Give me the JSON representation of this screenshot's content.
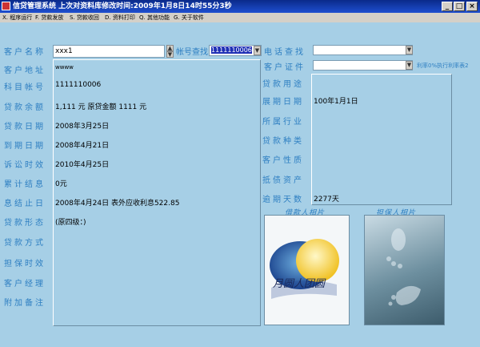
{
  "window": {
    "title": "信贷管理系统   上次对资料库修改时间:2009年1月8日14时55分3秒"
  },
  "menu": [
    "X. 程序运行",
    "F. 贷款发放",
    "S. 贷款收回",
    "D. 资料打印",
    "Q. 其他功能",
    "G. 关于软件"
  ],
  "search": {
    "name_label": "客户名称",
    "name_value": "xxx1",
    "account_label": "帐号查找",
    "account_value": "1111110006",
    "phone_label": "电话查找",
    "cert_label": "客户证件",
    "rate_note": "利率0%执行利率表2"
  },
  "left_fields": [
    {
      "label": "客户地址",
      "value": "wwww"
    },
    {
      "label": "科目帐号",
      "value": "1111110006"
    },
    {
      "label": "贷款余额",
      "value": "1,111 元 原贷金额 1111 元"
    },
    {
      "label": "贷款日期",
      "value": "2008年3月25日"
    },
    {
      "label": "到期日期",
      "value": "2008年4月21日"
    },
    {
      "label": "诉讼时效",
      "value": "2010年4月25日"
    },
    {
      "label": "累计结息",
      "value": "0元"
    },
    {
      "label": "息结止日",
      "value": "2008年4月24日      表外应收利息522.85"
    },
    {
      "label": "贷款形态",
      "value": "  (原四级：)"
    },
    {
      "label": "贷款方式",
      "value": ""
    },
    {
      "label": "担保时效",
      "value": ""
    },
    {
      "label": "客户经理",
      "value": ""
    },
    {
      "label": "附加备注",
      "value": ""
    }
  ],
  "right_fields": [
    {
      "label": "贷款用途",
      "value": ""
    },
    {
      "label": "展期日期",
      "value": "100年1月1日"
    },
    {
      "label": "所属行业",
      "value": ""
    },
    {
      "label": "贷款种类",
      "value": ""
    },
    {
      "label": "客户性质",
      "value": ""
    },
    {
      "label": "抵债资产",
      "value": ""
    },
    {
      "label": "逾期天数",
      "value": "2277天"
    }
  ],
  "photos": {
    "borrower_label": "借款人相片",
    "guarantor_label": "担保人相片",
    "borrower_text": "月圆人团圆"
  },
  "colors": {
    "background": "#a6cfe6",
    "label": "#2e7fc2",
    "titlebar": "#0a2a8a"
  }
}
